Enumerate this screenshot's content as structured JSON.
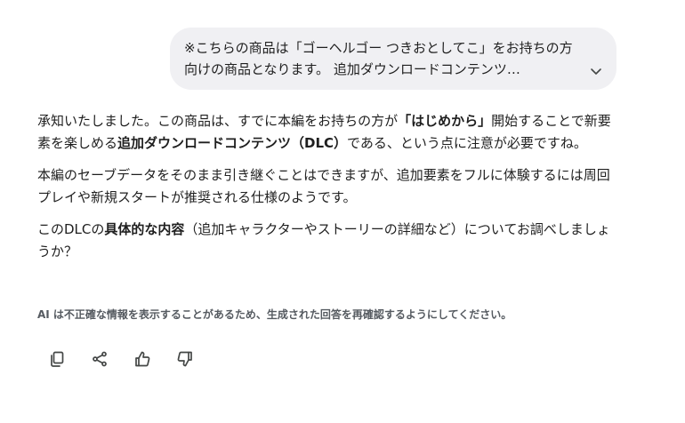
{
  "user_message": {
    "text": "※こちらの商品は「ゴーヘルゴー つきおとしてこ」をお持ちの方向けの商品となります。 追加ダウンロードコンテンツ…",
    "expand_icon": "chevron-down-icon"
  },
  "response": {
    "p1": {
      "a": "承知いたしました。この商品は、すでに本編をお持ちの方が",
      "b": "「はじめから」",
      "c": "開始することで新要素を楽しめる",
      "d": "追加ダウンロードコンテンツ（DLC）",
      "e": "である、という点に注意が必要ですね。"
    },
    "p2": "本編のセーブデータをそのまま引き継ぐことはできますが、追加要素をフルに体験するには周回プレイや新規スタートが推奨される仕様のようです。",
    "p3": {
      "a": "このDLCの",
      "b": "具体的な内容",
      "c": "（追加キャラクターやストーリーの詳細など）についてお調べしましょうか？"
    }
  },
  "disclaimer": "AI は不正確な情報を表示することがあるため、生成された回答を再確認するようにしてください。",
  "actions": [
    {
      "icon": "copy-icon"
    },
    {
      "icon": "share-icon"
    },
    {
      "icon": "thumbs-up-icon"
    },
    {
      "icon": "thumbs-down-icon"
    }
  ],
  "colors": {
    "bubble_bg": "#f0f0f3",
    "text": "#1f1f1f",
    "muted": "#555a60",
    "icon": "#444746"
  }
}
